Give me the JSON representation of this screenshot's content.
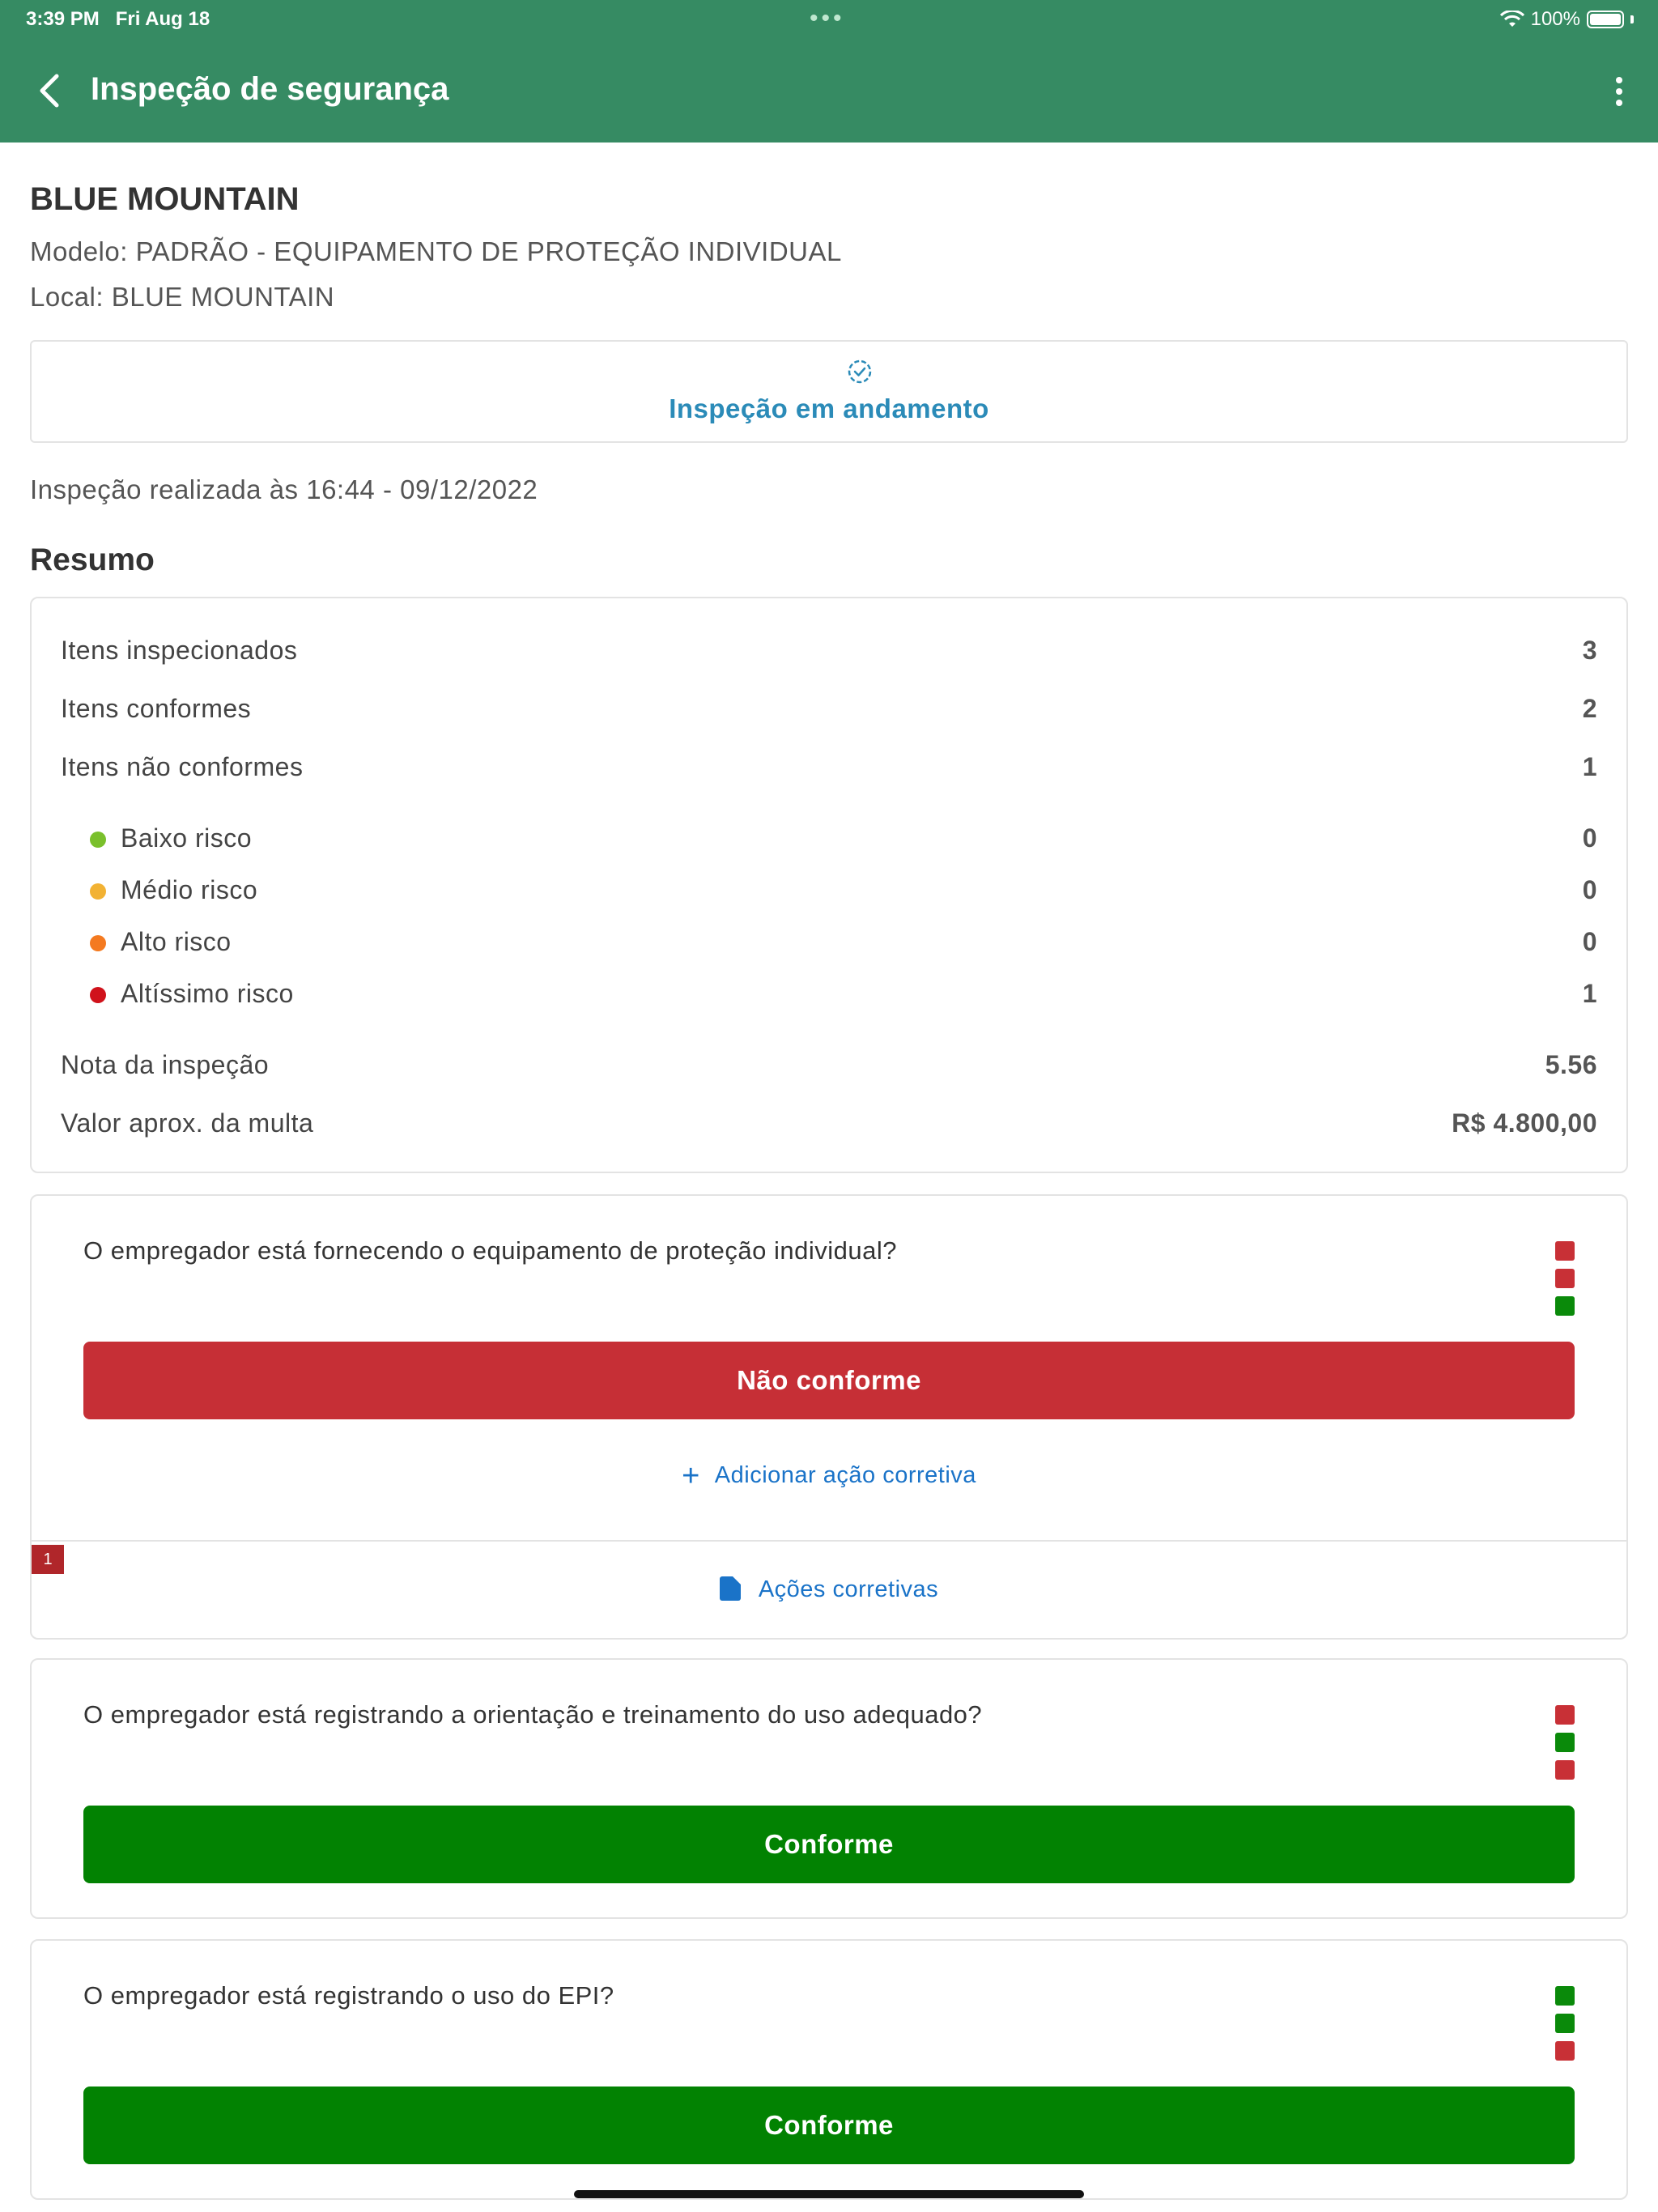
{
  "status_bar": {
    "time": "3:39 PM",
    "date": "Fri Aug 18",
    "battery": "100%"
  },
  "header": {
    "title": "Inspeção de segurança"
  },
  "site": {
    "name": "BLUE MOUNTAIN",
    "model": "Modelo: PADRÃO - EQUIPAMENTO DE PROTEÇÃO INDIVIDUAL",
    "local": "Local: BLUE MOUNTAIN"
  },
  "inspection_status": {
    "label": "Inspeção em andamento",
    "color": "#2b8bb8"
  },
  "performed_at": "Inspeção realizada às 16:44 - 09/12/2022",
  "summary": {
    "title": "Resumo",
    "inspected": {
      "label": "Itens inspecionados",
      "value": "3"
    },
    "compliant": {
      "label": "Itens conformes",
      "value": "2"
    },
    "non_compliant": {
      "label": "Itens não conformes",
      "value": "1"
    },
    "risks": [
      {
        "label": "Baixo risco",
        "value": "0",
        "color": "#7ac02c"
      },
      {
        "label": "Médio risco",
        "value": "0",
        "color": "#f2b233"
      },
      {
        "label": "Alto risco",
        "value": "0",
        "color": "#f47a20"
      },
      {
        "label": "Altíssimo risco",
        "value": "1",
        "color": "#d0121b"
      }
    ],
    "score": {
      "label": "Nota da inspeção",
      "value": "5.56"
    },
    "fine": {
      "label": "Valor aprox. da multa",
      "value": "R$ 4.800,00"
    }
  },
  "questions": [
    {
      "text": "O empregador está fornecendo o equipamento de proteção individual?",
      "marks": [
        "#c83036",
        "#c83036",
        "#0a8a0a"
      ],
      "answer": "Não conforme",
      "answer_color": "#c62f36",
      "add_action": "Adicionar ação corretiva",
      "actions_count": "1",
      "actions_link": "Ações corretivas"
    },
    {
      "text": "O empregador está registrando a orientação e treinamento do uso adequado?",
      "marks": [
        "#c83036",
        "#0a8a0a",
        "#c83036"
      ],
      "answer": "Conforme",
      "answer_color": "#028202"
    },
    {
      "text": "O empregador está registrando o uso do EPI?",
      "marks": [
        "#0a8a0a",
        "#0a8a0a",
        "#c83036"
      ],
      "answer": "Conforme",
      "answer_color": "#028202"
    }
  ]
}
